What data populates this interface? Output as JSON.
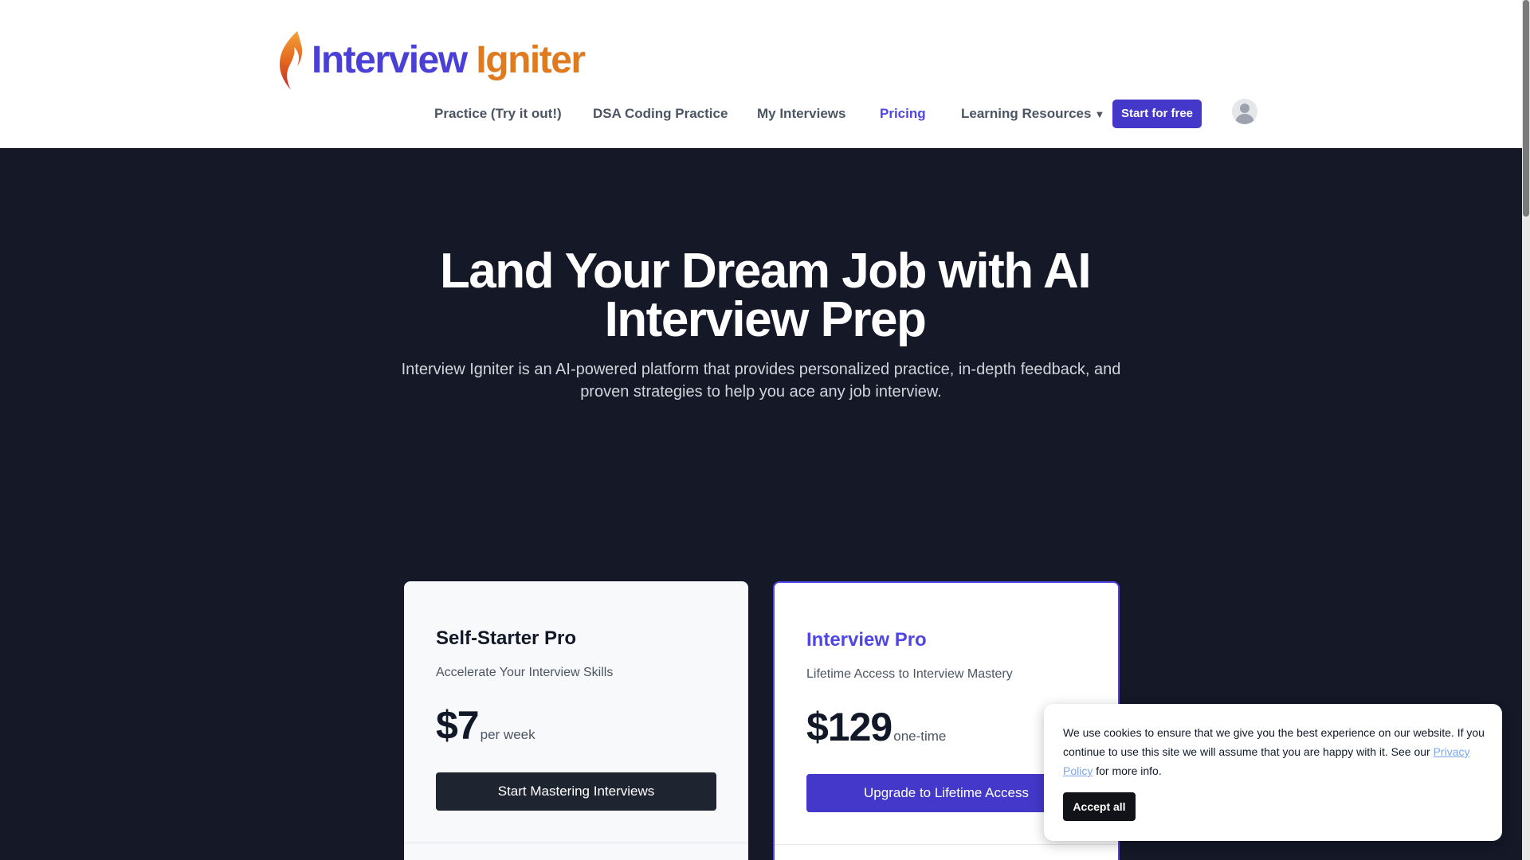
{
  "brand": {
    "word1": "Interview",
    "word2": "Igniter",
    "color_primary": "#4a3fd6",
    "color_accent": "#e07a1f"
  },
  "nav": {
    "items": [
      {
        "label": "Practice (Try it out!)",
        "active": false
      },
      {
        "label": "DSA Coding Practice",
        "active": false
      },
      {
        "label": "My Interviews",
        "active": false
      },
      {
        "label": "Pricing",
        "active": true
      },
      {
        "label": "Learning Resources",
        "active": false,
        "caret": "▼"
      }
    ],
    "cta": "Start for free",
    "avatar_icon": "user-avatar-icon"
  },
  "hero": {
    "title_line1": "Land Your Dream Job with AI",
    "title_line2": "Interview Prep",
    "subtitle_line1": "Interview Igniter is an AI-powered platform that provides personalized practice, in-depth feedback, and",
    "subtitle_line2": "proven strategies to help you ace any job interview."
  },
  "plans": [
    {
      "name": "Self-Starter Pro",
      "tagline": "Accelerate Your Interview Skills",
      "price": "$7",
      "period": "per week",
      "button": "Start Mastering Interviews",
      "highlighted": false
    },
    {
      "name": "Interview Pro",
      "tagline": "Lifetime Access to Interview Mastery",
      "price": "$129",
      "period": "one-time",
      "button": "Upgrade to Lifetime Access",
      "highlighted": true
    }
  ],
  "cookie": {
    "text_before": "We use cookies to ensure that we give you the best experience on our website. If you continue to use this site we will assume that you are happy with it. See our ",
    "link": "Privacy Policy",
    "text_after": " for more info.",
    "accept": "Accept all"
  },
  "colors": {
    "hero_bg": "#141827",
    "brand_indigo": "#4338ca",
    "active_nav": "#4f46e5"
  }
}
